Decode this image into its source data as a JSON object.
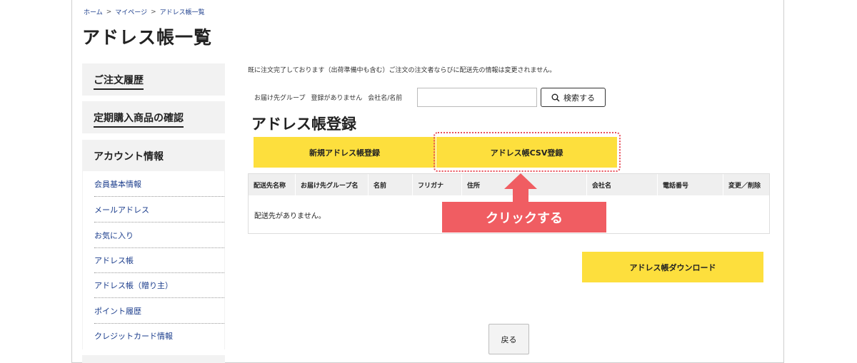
{
  "breadcrumb": [
    "ホーム",
    "マイページ",
    "アドレス帳一覧"
  ],
  "breadcrumb_separator": ">",
  "page_title": "アドレス帳一覧",
  "sidebar": {
    "order_history": "ご注文履歴",
    "subscription": "定期購入商品の確認",
    "account_heading": "アカウント情報",
    "items": [
      "会員基本情報",
      "メールアドレス",
      "お気に入り",
      "アドレス帳",
      "アドレス帳（贈り主）",
      "ポイント履歴",
      "クレジットカード情報"
    ]
  },
  "notice": "既に注文完了しております（出荷準備中も含む）ご注文の注文者ならびに配送先の情報は変更されません。",
  "search": {
    "group_label": "お届け先グループ",
    "group_value": "登録がありません",
    "company_label": "会社名/名前",
    "input_value": "",
    "button_label": "検索する"
  },
  "section_title": "アドレス帳登録",
  "buttons": {
    "new_address": "新規アドレス帳登録",
    "csv_register": "アドレス帳CSV登録",
    "download": "アドレス帳ダウンロード",
    "back": "戻る"
  },
  "table": {
    "headers": [
      "配送先名称",
      "お届け先グループ名",
      "名前",
      "フリガナ",
      "住所",
      "会社名",
      "電話番号",
      "変更／削除"
    ],
    "empty_message": "配送先がありません。"
  },
  "annotation": {
    "callout_text": "クリックする"
  },
  "colors": {
    "yellow_button": "#fddf3d",
    "callout_red": "#f05d62",
    "link_blue": "#1b3d8c",
    "sidebar_bg": "#f2f2f2"
  }
}
